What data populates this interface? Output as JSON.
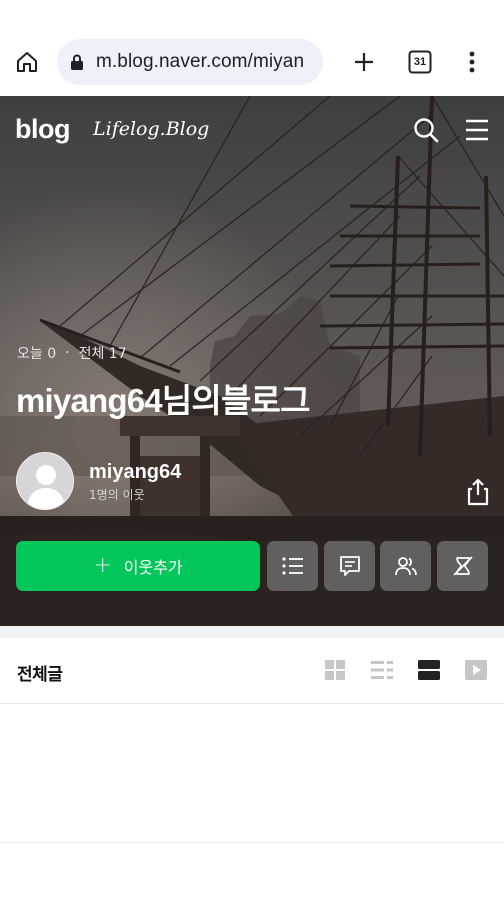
{
  "browser": {
    "url": "m.blog.naver.com/miyan",
    "tab_count": "31",
    "icons": {
      "home": "home-icon",
      "lock": "lock-icon",
      "new_tab": "plus-icon",
      "tabs": "tab-switcher-icon",
      "menu": "more-vert-icon"
    }
  },
  "header": {
    "logo": "blog",
    "subtitle": "Lifelog.Blog",
    "icons": {
      "search": "search-icon",
      "menu": "hamburger-icon"
    }
  },
  "blog": {
    "today_label": "오늘 0",
    "total_label": "전체 17",
    "separator": "·",
    "title": "miyang64님의블로그",
    "owner_name": "miyang64",
    "neighbor_count": "1명의 이웃",
    "add_neighbor_label": "이웃추가",
    "add_icon": "+",
    "action_icons": [
      "list-icon",
      "memo-icon",
      "neighbors-icon",
      "hide-icon"
    ]
  },
  "posts": {
    "header_title": "전체글",
    "view_modes": [
      "grid-view-icon",
      "list-view-icon",
      "card-view-icon",
      "video-view-icon"
    ],
    "active_view": "card-view-icon"
  },
  "colors": {
    "accent": "#03c75a",
    "url_bg": "#eef1f8"
  }
}
